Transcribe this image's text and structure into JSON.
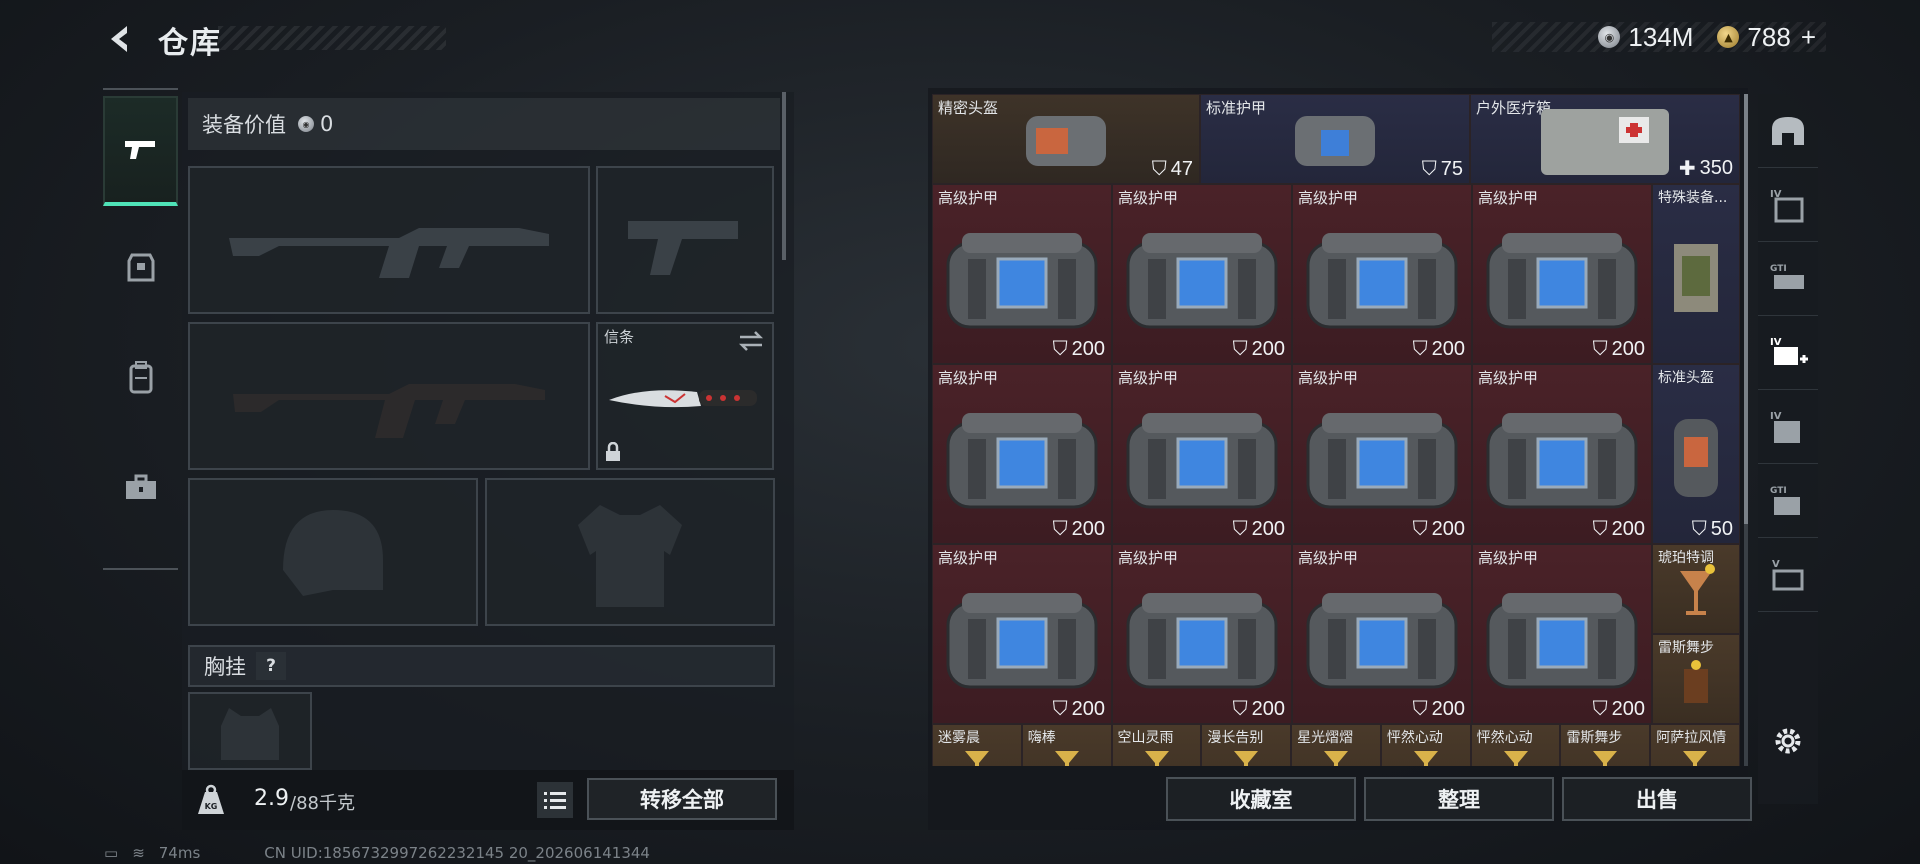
{
  "header": {
    "title": "仓库",
    "currency": [
      {
        "icon": "silver-coin-icon",
        "value": "134M"
      },
      {
        "icon": "gold-coin-icon",
        "value": "788"
      }
    ],
    "add_label": "+"
  },
  "equipment": {
    "value_label": "装备价值",
    "value": "0",
    "melee_slot_label": "信条",
    "chest_rig_label": "胸挂",
    "help_label": "?"
  },
  "weight": {
    "current": "2.9",
    "max_unit": "/88千克",
    "badge": "KG"
  },
  "actions": {
    "transfer_all": "转移全部",
    "collection": "收藏室",
    "sort": "整理",
    "sell": "出售"
  },
  "inventory": {
    "top_row": [
      {
        "name": "精密头盔",
        "value": "47",
        "color": "brown"
      },
      {
        "name": "标准护甲",
        "value": "75",
        "color": "navy"
      },
      {
        "name": "户外医疗箱",
        "value": "350",
        "color": "navy"
      }
    ],
    "armor_name": "高级护甲",
    "armor_value": "200",
    "side_items": [
      {
        "name": "特殊装备...",
        "value": ""
      },
      {
        "name": "标准头盔",
        "value": "50"
      },
      {
        "name": "琥珀特调",
        "value": ""
      },
      {
        "name": "雷斯舞步",
        "value": ""
      }
    ],
    "bottom_row": [
      "迷雾晨",
      "嗨棒",
      "空山灵雨",
      "漫长告别",
      "星光熠熠",
      "怦然心动",
      "怦然心动",
      "雷斯舞步",
      "阿萨拉风情"
    ]
  },
  "status": {
    "ping": "74ms",
    "uid": "CN UID:1856732997262232145 20_202606141344"
  }
}
